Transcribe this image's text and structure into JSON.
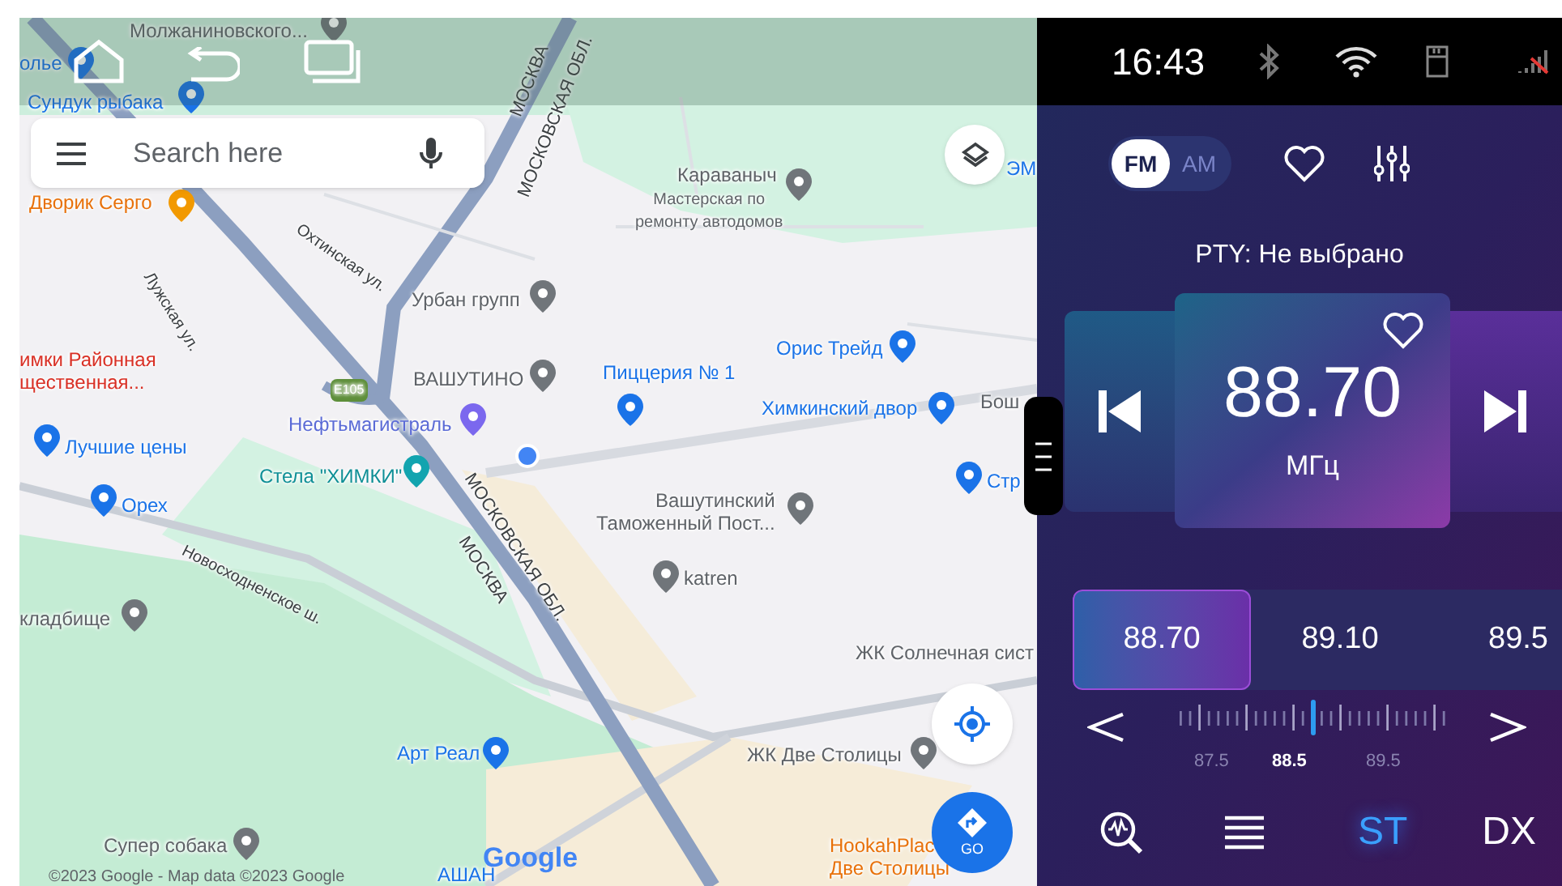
{
  "search": {
    "placeholder": "Search here"
  },
  "map": {
    "labels": [
      {
        "text": "Молжаниновского...",
        "kind": "place"
      },
      {
        "text": "олье",
        "kind": "shop"
      },
      {
        "text": "Сундук рыбака",
        "kind": "shop"
      },
      {
        "text": "Дворик Серго",
        "kind": "food"
      },
      {
        "text": "Охтинская ул.",
        "kind": "road"
      },
      {
        "text": "Лужская ул.",
        "kind": "road"
      },
      {
        "text": "Урбан групп",
        "kind": "place"
      },
      {
        "text": "имки Районная\nщественная...",
        "kind": "district"
      },
      {
        "text": "ВАШУТИНО",
        "kind": "place"
      },
      {
        "text": "E105",
        "kind": "shield"
      },
      {
        "text": "Нефтьмагистраль",
        "kind": "gas"
      },
      {
        "text": "Лучшие цены",
        "kind": "shop"
      },
      {
        "text": "Стела \"ХИМКИ\"",
        "kind": "sight"
      },
      {
        "text": "Орех",
        "kind": "shop"
      },
      {
        "text": "Новосходненское ш.",
        "kind": "road"
      },
      {
        "text": "кладбище",
        "kind": "place"
      },
      {
        "text": "МОСКВА",
        "kind": "highway"
      },
      {
        "text": "МОСКОВСКАЯ ОБЛ.",
        "kind": "highway"
      },
      {
        "text": "МОСКОВСКАЯ ОБЛ.",
        "kind": "highway"
      },
      {
        "text": "МОСКВА",
        "kind": "highway"
      },
      {
        "text": "Караваныч",
        "kind": "place"
      },
      {
        "text": "Мастерская по\nремонту автодомов",
        "kind": "note"
      },
      {
        "text": "ЭМ",
        "kind": "shop"
      },
      {
        "text": "Пиццерия № 1",
        "kind": "cart"
      },
      {
        "text": "Орис Трейд",
        "kind": "shop"
      },
      {
        "text": "Химкинский двор",
        "kind": "cart"
      },
      {
        "text": "Бош",
        "kind": "place"
      },
      {
        "text": "Стр",
        "kind": "cart"
      },
      {
        "text": "Вашутинский\nТаможенный Пост...",
        "kind": "gov"
      },
      {
        "text": "katren",
        "kind": "place"
      },
      {
        "text": "ЖК Солнечная сист",
        "kind": "place"
      },
      {
        "text": "Арт Реал",
        "kind": "shop"
      },
      {
        "text": "ЖК Две Столицы",
        "kind": "place"
      },
      {
        "text": "Супер собака",
        "kind": "place"
      },
      {
        "text": "АШАН",
        "kind": "shop"
      },
      {
        "text": "HookahPlac\nДве Столицы",
        "kind": "food"
      }
    ],
    "logo": "Google",
    "copyright": "©2023 Google - Map data ©2023 Google"
  },
  "go_button": {
    "label": "GO"
  },
  "radio": {
    "time": "16:43",
    "bands": [
      {
        "label": "FM",
        "selected": true
      },
      {
        "label": "AM",
        "selected": false
      }
    ],
    "pty": "PTY: Не выбрано",
    "frequency": "88.70",
    "unit": "МГц",
    "presets": [
      {
        "label": "88.70",
        "selected": true
      },
      {
        "label": "89.10",
        "selected": false
      },
      {
        "label": "89.5",
        "selected": false
      }
    ],
    "tuner": {
      "level": 0.5,
      "scale": [
        {
          "label": "87.5",
          "selected": false
        },
        {
          "label": "88.5",
          "selected": true
        },
        {
          "label": "89.5",
          "selected": false
        }
      ]
    },
    "toggles": [
      {
        "label": "ST",
        "on": true
      },
      {
        "label": "DX",
        "on": false
      }
    ]
  }
}
